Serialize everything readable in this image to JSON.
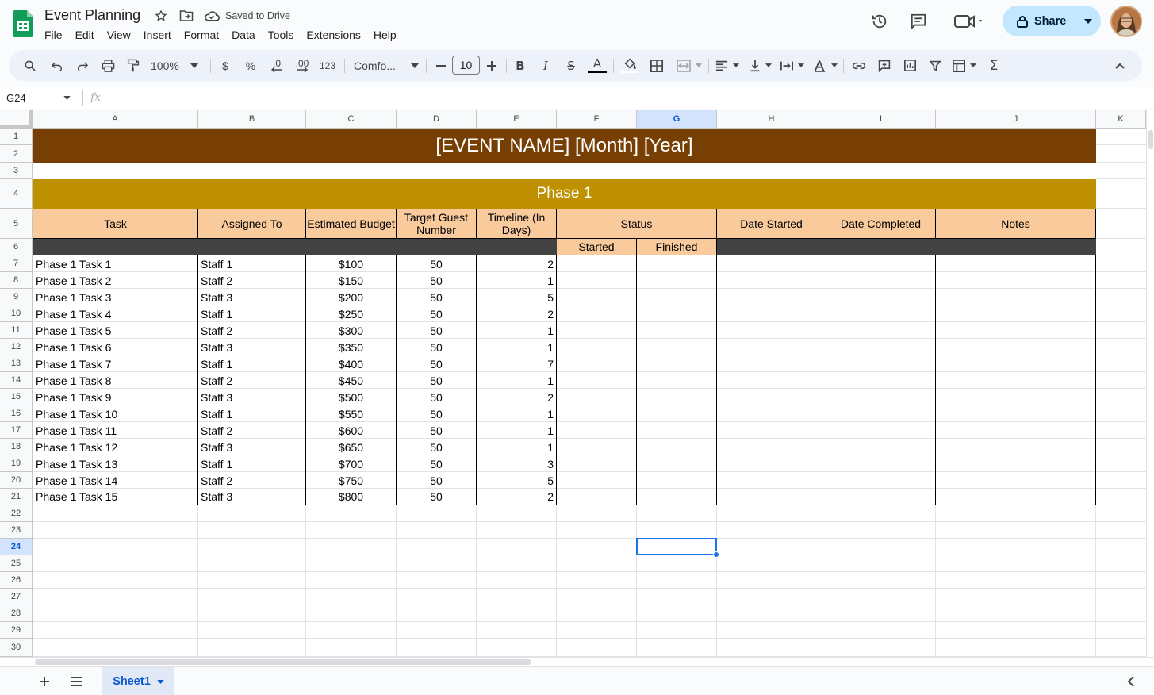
{
  "header": {
    "doc_title": "Event Planning",
    "saved_status": "Saved to Drive",
    "share_label": "Share"
  },
  "menu": [
    "File",
    "Edit",
    "View",
    "Insert",
    "Format",
    "Data",
    "Tools",
    "Extensions",
    "Help"
  ],
  "toolbar": {
    "zoom": "100%",
    "currency": "$",
    "percent": "%",
    "dec_decrease": ".0",
    "dec_increase": ".00",
    "number_format": "123",
    "font": "Comfo...",
    "font_size": "10"
  },
  "formula_bar": {
    "name_box": "G24",
    "fx": "fx"
  },
  "columns": [
    "A",
    "B",
    "C",
    "D",
    "E",
    "F",
    "G",
    "H",
    "I",
    "J",
    "K"
  ],
  "rows": [
    "1",
    "2",
    "3",
    "4",
    "5",
    "6",
    "7",
    "8",
    "9",
    "10",
    "11",
    "12",
    "13",
    "14",
    "15",
    "16",
    "17",
    "18",
    "19",
    "20",
    "21",
    "22",
    "23",
    "24",
    "25",
    "26",
    "27",
    "28",
    "29",
    "30"
  ],
  "selected_cell": "G24",
  "sheet": {
    "banner": "[EVENT NAME] [Month] [Year]",
    "phase": "Phase 1",
    "headers": {
      "task": "Task",
      "assigned": "Assigned To",
      "budget": "Estimated Budget",
      "guests": "Target Guest Number",
      "timeline": "Timeline (In Days)",
      "status": "Status",
      "started": "Started",
      "finished": "Finished",
      "date_started": "Date Started",
      "date_completed": "Date Completed",
      "notes": "Notes"
    },
    "tasks": [
      {
        "task": "Phase 1 Task 1",
        "assigned": "Staff 1",
        "budget": "$100",
        "guests": "50",
        "timeline": "2"
      },
      {
        "task": "Phase 1 Task 2",
        "assigned": "Staff 2",
        "budget": "$150",
        "guests": "50",
        "timeline": "1"
      },
      {
        "task": "Phase 1 Task 3",
        "assigned": "Staff 3",
        "budget": "$200",
        "guests": "50",
        "timeline": "5"
      },
      {
        "task": "Phase 1 Task 4",
        "assigned": "Staff 1",
        "budget": "$250",
        "guests": "50",
        "timeline": "2"
      },
      {
        "task": "Phase 1 Task 5",
        "assigned": "Staff 2",
        "budget": "$300",
        "guests": "50",
        "timeline": "1"
      },
      {
        "task": "Phase 1 Task 6",
        "assigned": "Staff 3",
        "budget": "$350",
        "guests": "50",
        "timeline": "1"
      },
      {
        "task": "Phase 1 Task 7",
        "assigned": "Staff 1",
        "budget": "$400",
        "guests": "50",
        "timeline": "7"
      },
      {
        "task": "Phase 1 Task 8",
        "assigned": "Staff 2",
        "budget": "$450",
        "guests": "50",
        "timeline": "1"
      },
      {
        "task": "Phase 1 Task 9",
        "assigned": "Staff 3",
        "budget": "$500",
        "guests": "50",
        "timeline": "2"
      },
      {
        "task": "Phase 1 Task 10",
        "assigned": "Staff 1",
        "budget": "$550",
        "guests": "50",
        "timeline": "1"
      },
      {
        "task": "Phase 1 Task 11",
        "assigned": "Staff 2",
        "budget": "$600",
        "guests": "50",
        "timeline": "1"
      },
      {
        "task": "Phase 1 Task 12",
        "assigned": "Staff 3",
        "budget": "$650",
        "guests": "50",
        "timeline": "1"
      },
      {
        "task": "Phase 1 Task 13",
        "assigned": "Staff 1",
        "budget": "$700",
        "guests": "50",
        "timeline": "3"
      },
      {
        "task": "Phase 1 Task 14",
        "assigned": "Staff 2",
        "budget": "$750",
        "guests": "50",
        "timeline": "5"
      },
      {
        "task": "Phase 1 Task 15",
        "assigned": "Staff 3",
        "budget": "$800",
        "guests": "50",
        "timeline": "2"
      }
    ]
  },
  "bottom": {
    "sheet_tab": "Sheet1"
  },
  "colors": {
    "banner": "#783f04",
    "phase": "#bf9000",
    "header": "#f9cb9c",
    "dark_row": "#434343",
    "accent": "#0b57d0",
    "share_bg": "#c2e7ff"
  }
}
